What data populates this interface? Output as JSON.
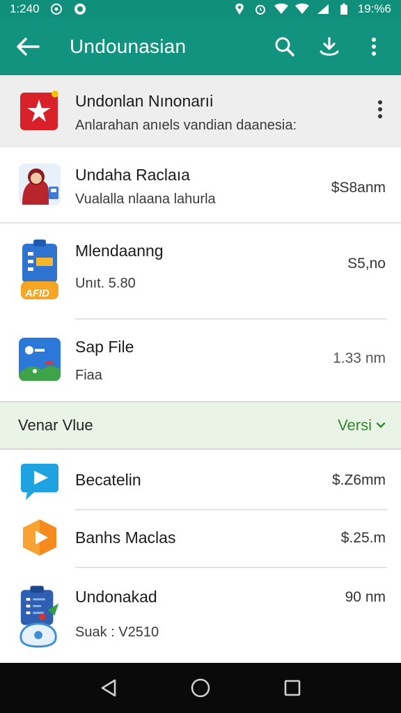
{
  "status_bar": {
    "time": "1:240",
    "battery": "19:%6"
  },
  "app_bar": {
    "title": "Undounasian"
  },
  "featured": {
    "name": "Undonlan Nınonarıi",
    "subtitle": "Anlarahan anıels vandian daanesia:"
  },
  "apps_top": [
    {
      "name": "Undaha Raclaıa",
      "subtitle": "Vualalla nlaana lahurla",
      "size": "$S8anm"
    },
    {
      "name": "Mlendaanng",
      "subtitle": "Unıt. 5.80",
      "size": "S5,no"
    },
    {
      "name": "Sap File",
      "subtitle": "Fiaa",
      "size": "1.33 nm"
    }
  ],
  "section": {
    "label": "Venar Vlue",
    "version_label": "Versi"
  },
  "apps_bottom": [
    {
      "name": "Becatelin",
      "subtitle": "",
      "size": "$.Z6mm"
    },
    {
      "name": "Banhs Maclas",
      "subtitle": "",
      "size": "$.25.m"
    },
    {
      "name": "Undonakad",
      "subtitle": "Suak : V2510",
      "size": "90 nm"
    }
  ],
  "icon_labels": {
    "mlendaanng_badge": "AFID"
  },
  "colors": {
    "app_bar": "#12937f",
    "status_bar": "#0f8f7c",
    "section_bg": "#eaf4e6",
    "version_accent": "#2d8a2d"
  }
}
